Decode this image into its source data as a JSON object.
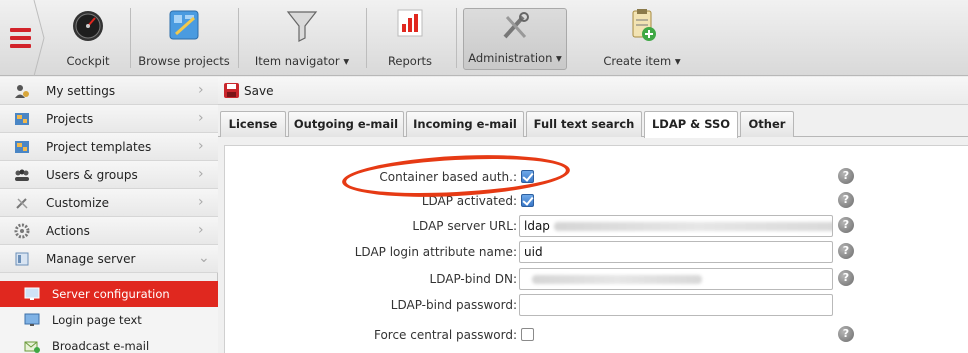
{
  "toolbar": {
    "items": [
      {
        "label": "Cockpit",
        "icon": "gauge-icon"
      },
      {
        "label": "Browse projects",
        "icon": "browse-projects-icon"
      },
      {
        "label": "Item navigator",
        "icon": "funnel-icon",
        "dropdown": "▾"
      },
      {
        "label": "Reports",
        "icon": "bar-chart-icon"
      },
      {
        "label": "Administration",
        "icon": "tools-icon",
        "dropdown": "▾"
      },
      {
        "label": "Create item",
        "icon": "clipboard-add-icon",
        "dropdown": "▾"
      }
    ]
  },
  "sidebar": {
    "items": [
      {
        "label": "My settings",
        "icon": "user-gear-icon"
      },
      {
        "label": "Projects",
        "icon": "projects-icon"
      },
      {
        "label": "Project templates",
        "icon": "project-templates-icon"
      },
      {
        "label": "Users & groups",
        "icon": "users-icon"
      },
      {
        "label": "Customize",
        "icon": "wrench-icon"
      },
      {
        "label": "Actions",
        "icon": "gear-icon"
      },
      {
        "label": "Manage server",
        "icon": "server-icon"
      }
    ],
    "subitems": [
      {
        "label": "Server configuration",
        "icon": "monitor-icon",
        "selected": true
      },
      {
        "label": "Login page text",
        "icon": "monitor-login-icon"
      },
      {
        "label": "Broadcast e-mail",
        "icon": "broadcast-mail-icon"
      }
    ]
  },
  "main": {
    "save_label": "Save",
    "tabs": [
      {
        "label": "License"
      },
      {
        "label": "Outgoing e-mail"
      },
      {
        "label": "Incoming e-mail"
      },
      {
        "label": "Full text search"
      },
      {
        "label": "LDAP & SSO",
        "active": true
      },
      {
        "label": "Other"
      }
    ],
    "form": {
      "rows": [
        {
          "label": "Container based auth.:",
          "type": "checkbox",
          "checked": true,
          "help": true
        },
        {
          "label": "LDAP activated:",
          "type": "checkbox",
          "checked": true,
          "help": true
        },
        {
          "label": "LDAP server URL:",
          "type": "text",
          "value": "ldap",
          "help": true
        },
        {
          "label": "LDAP login attribute name:",
          "type": "text",
          "value": "uid",
          "help": true
        },
        {
          "label": "LDAP-bind DN:",
          "type": "text",
          "value": "",
          "help": true
        },
        {
          "label": "LDAP-bind password:",
          "type": "text",
          "value": "",
          "help": false
        },
        {
          "label": "Force central password:",
          "type": "checkbox",
          "checked": false,
          "help": true
        }
      ],
      "help_symbol": "?"
    }
  },
  "colors": {
    "accent": "#e0281f",
    "highlight_ring": "#e63a14",
    "checkbox_blue": "#3a78c8"
  }
}
